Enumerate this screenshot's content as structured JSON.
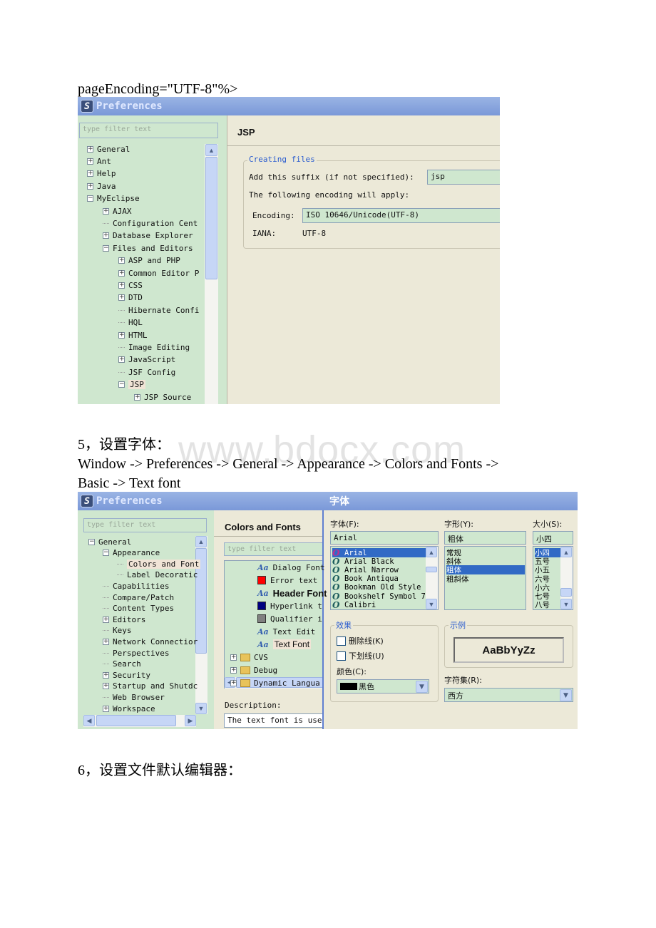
{
  "doc": {
    "line_page_encoding": "pageEncoding=\"UTF-8\"%>",
    "step5_heading": "5，设置字体：",
    "step5_path_line1": "Window -> Preferences -> General -> Appearance -> Colors and Fonts ->",
    "step5_path_line2": "Basic -> Text font",
    "step6_heading": "6，设置文件默认编辑器：",
    "watermark": "www.bdocx.com"
  },
  "shot1": {
    "window_title": "Preferences",
    "filter_placeholder": "type filter text",
    "tree": [
      {
        "label": "General",
        "state": "collapsed",
        "level": 0
      },
      {
        "label": "Ant",
        "state": "collapsed",
        "level": 0
      },
      {
        "label": "Help",
        "state": "collapsed",
        "level": 0
      },
      {
        "label": "Java",
        "state": "collapsed",
        "level": 0
      },
      {
        "label": "MyEclipse",
        "state": "expanded",
        "level": 0
      },
      {
        "label": "AJAX",
        "state": "collapsed",
        "level": 1
      },
      {
        "label": "Configuration Cent",
        "state": "leaf",
        "level": 1
      },
      {
        "label": "Database Explorer",
        "state": "collapsed",
        "level": 1
      },
      {
        "label": "Files and Editors",
        "state": "expanded",
        "level": 1
      },
      {
        "label": "ASP and PHP",
        "state": "collapsed",
        "level": 2
      },
      {
        "label": "Common Editor P",
        "state": "collapsed",
        "level": 2
      },
      {
        "label": "CSS",
        "state": "collapsed",
        "level": 2
      },
      {
        "label": "DTD",
        "state": "collapsed",
        "level": 2
      },
      {
        "label": "Hibernate Confi",
        "state": "leaf",
        "level": 2
      },
      {
        "label": "HQL",
        "state": "leaf",
        "level": 2
      },
      {
        "label": "HTML",
        "state": "collapsed",
        "level": 2
      },
      {
        "label": "Image Editing",
        "state": "leaf",
        "level": 2
      },
      {
        "label": "JavaScript",
        "state": "collapsed",
        "level": 2
      },
      {
        "label": "JSF Config",
        "state": "leaf",
        "level": 2
      },
      {
        "label": "JSP",
        "state": "expanded",
        "level": 2,
        "selected": true
      },
      {
        "label": "JSP Source",
        "state": "collapsed",
        "level": 3
      }
    ],
    "page_title": "JSP",
    "group_label": "Creating files",
    "suffix_label": "Add this suffix (if not specified):",
    "suffix_value": "jsp",
    "encoding_note": "The following encoding will apply:",
    "encoding_label": "Encoding:",
    "encoding_value": "ISO 10646/Unicode(UTF-8)",
    "iana_label": "IANA:",
    "iana_value": "UTF-8"
  },
  "shot2": {
    "window_title": "Preferences",
    "filter_placeholder": "type filter text",
    "tree": [
      {
        "label": "General",
        "state": "expanded",
        "level": 0
      },
      {
        "label": "Appearance",
        "state": "expanded",
        "level": 1
      },
      {
        "label": "Colors and Font",
        "state": "leaf",
        "level": 2,
        "selected": true
      },
      {
        "label": "Label Decoratic",
        "state": "leaf",
        "level": 2
      },
      {
        "label": "Capabilities",
        "state": "leaf",
        "level": 1
      },
      {
        "label": "Compare/Patch",
        "state": "leaf",
        "level": 1
      },
      {
        "label": "Content Types",
        "state": "leaf",
        "level": 1
      },
      {
        "label": "Editors",
        "state": "collapsed",
        "level": 1
      },
      {
        "label": "Keys",
        "state": "leaf",
        "level": 1
      },
      {
        "label": "Network Connectior",
        "state": "collapsed",
        "level": 1
      },
      {
        "label": "Perspectives",
        "state": "leaf",
        "level": 1
      },
      {
        "label": "Search",
        "state": "leaf",
        "level": 1
      },
      {
        "label": "Security",
        "state": "collapsed",
        "level": 1
      },
      {
        "label": "Startup and Shutdc",
        "state": "collapsed",
        "level": 1
      },
      {
        "label": "Web Browser",
        "state": "leaf",
        "level": 1
      },
      {
        "label": "Workspace",
        "state": "collapsed",
        "level": 1
      }
    ],
    "page_title": "Colors and Fonts",
    "inner_filter_placeholder": "type filter text",
    "inner_tree": [
      {
        "label": "Dialog Font",
        "icon": "font-icon"
      },
      {
        "label": "Error text",
        "icon": "color-swatch",
        "color": "#ff0000"
      },
      {
        "label": "Header Font",
        "icon": "font-icon",
        "bold": true
      },
      {
        "label": "Hyperlink t",
        "icon": "color-swatch",
        "color": "#000080"
      },
      {
        "label": "Qualifier i",
        "icon": "color-swatch",
        "color": "#808080"
      },
      {
        "label": "Text Edit",
        "icon": "font-icon"
      },
      {
        "label": "Text Font",
        "icon": "font-icon",
        "selected": true
      },
      {
        "label": "CVS",
        "icon": "folder-icon",
        "state": "collapsed"
      },
      {
        "label": "Debug",
        "icon": "folder-icon",
        "state": "collapsed"
      },
      {
        "label": "Dynamic Langua",
        "icon": "folder-icon",
        "state": "collapsed"
      }
    ],
    "description_label": "Description:",
    "description_text": "The text font is used"
  },
  "font_dialog": {
    "title": "字体",
    "font_label": "字体(F):",
    "font_value": "Arial",
    "fonts": [
      "Arial",
      "Arial Black",
      "Arial Narrow",
      "Book Antiqua",
      "Bookman Old Style",
      "Bookshelf Symbol 7",
      "Calibri"
    ],
    "font_selected_index": 0,
    "style_label": "字形(Y):",
    "style_value": "粗体",
    "styles": [
      "常规",
      "斜体",
      "粗体",
      "粗斜体"
    ],
    "style_selected_index": 2,
    "size_label": "大小(S):",
    "size_value": "小四",
    "sizes": [
      "小四",
      "五号",
      "小五",
      "六号",
      "小六",
      "七号",
      "八号"
    ],
    "size_selected_index": 0,
    "effects_label": "效果",
    "strikeout_label": "删除线(K)",
    "strikeout_checked": false,
    "underline_label": "下划线(U)",
    "underline_checked": false,
    "color_label": "颜色(C):",
    "color_value": "黑色",
    "color_hex": "#000000",
    "sample_label": "示例",
    "sample_text": "AaBbYyZz",
    "charset_label": "字符集(R):",
    "charset_value": "西方"
  },
  "colors": {
    "titlebar": "#7a98d8",
    "tree_bg": "#cfe7cf",
    "dialog_bg": "#ece9d8",
    "selection": "#316ac5",
    "group_label": "#2a5ccf"
  }
}
